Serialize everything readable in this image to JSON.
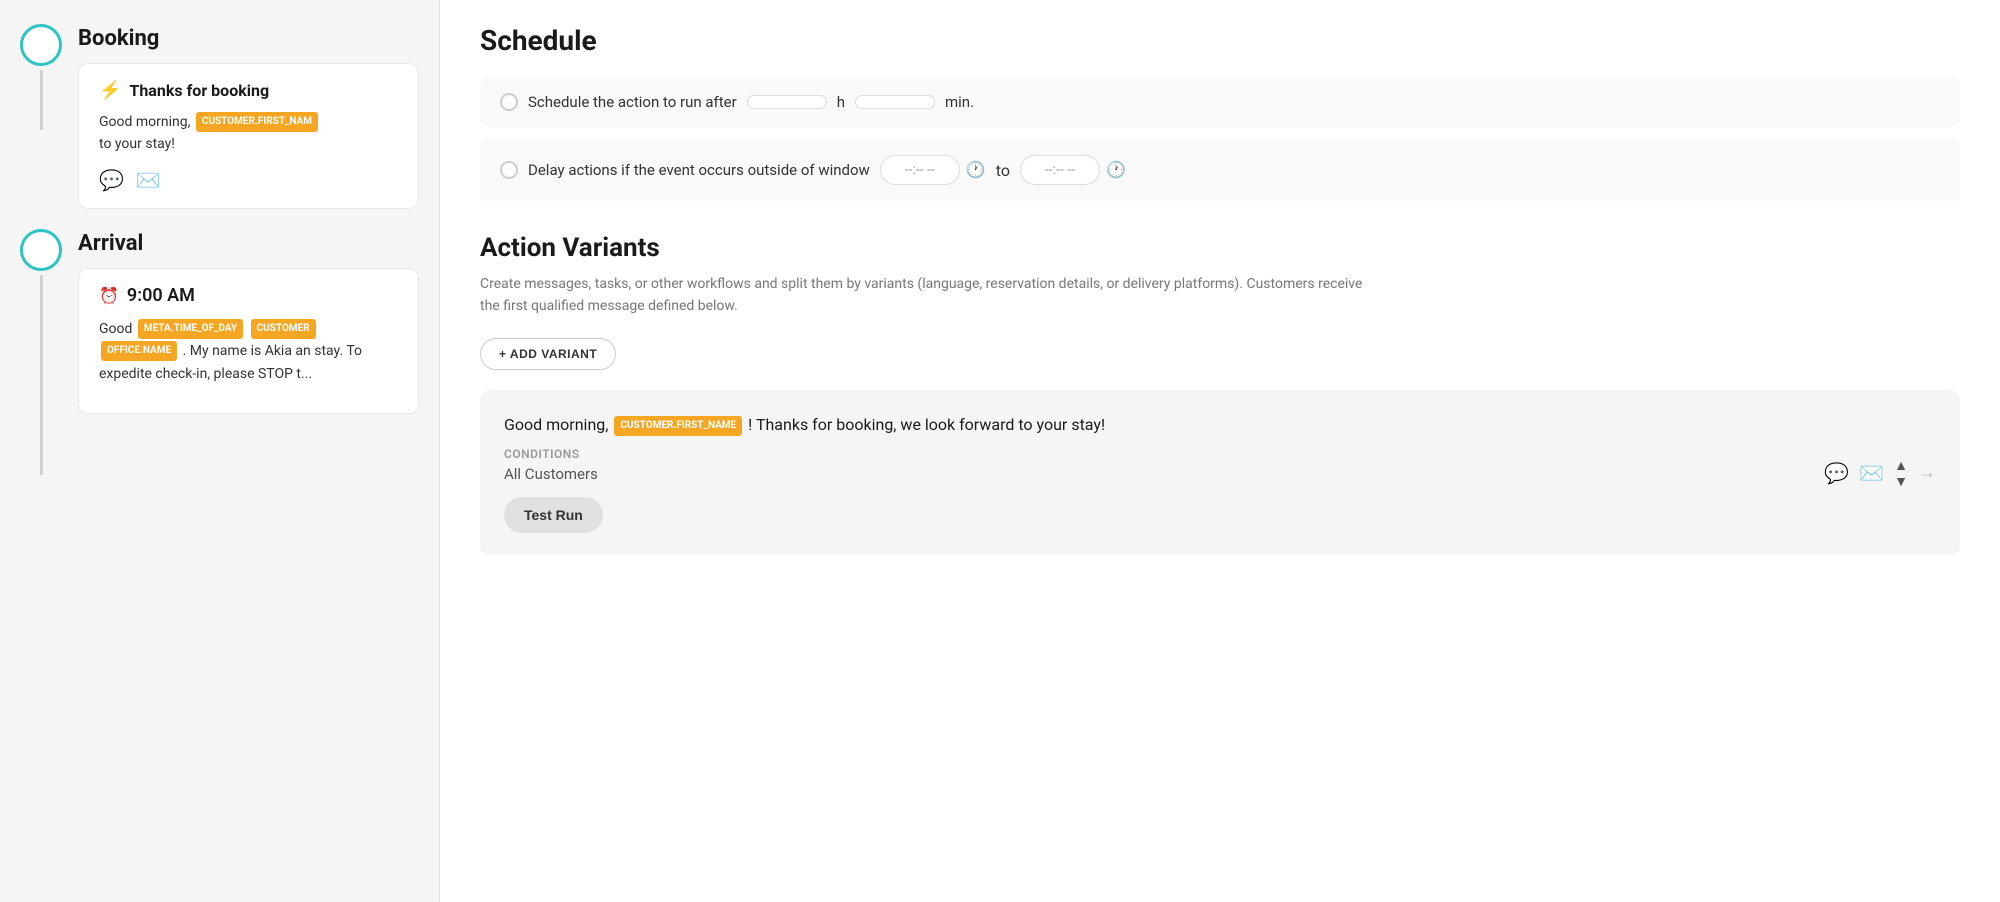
{
  "left": {
    "booking": {
      "title": "Booking",
      "card": {
        "icon": "⚡",
        "title": "Thanks for booking",
        "message_start": "Good morning,",
        "tag1": "CUSTOMER.FIRST_NAM",
        "message_end": "to your stay!"
      }
    },
    "arrival": {
      "title": "Arrival",
      "card": {
        "icon": "🕐",
        "time": "9:00 AM",
        "message_start": "Good",
        "tag1": "META.TIME_OF_DAY",
        "tag2": "CUSTOMER",
        "tag3": "OFFICE.NAME",
        "message_end": ". My name is Akia an stay. To expedite check-in, please STOP t..."
      }
    }
  },
  "right": {
    "schedule_heading": "Schedule",
    "row1": {
      "label": "Schedule the action to run after",
      "unit_h": "h",
      "unit_min": "min."
    },
    "row2": {
      "label": "Delay actions if the event occurs outside of window",
      "placeholder1": "--:-- --",
      "to_label": "to",
      "placeholder2": "--:-- --"
    },
    "action_variants": {
      "title": "Action Variants",
      "description": "Create messages, tasks, or other workflows and split them by variants (language, reservation details, or delivery platforms). Customers receive the first qualified message defined below.",
      "add_btn": "+ ADD VARIANT"
    },
    "variant_card": {
      "message_start": "Good morning,",
      "tag": "CUSTOMER.FIRST_NAME",
      "message_end": "! Thanks for booking, we look forward to your stay!",
      "conditions_label": "CONDITIONS",
      "conditions_value": "All Customers",
      "test_run_btn": "Test Run"
    }
  }
}
